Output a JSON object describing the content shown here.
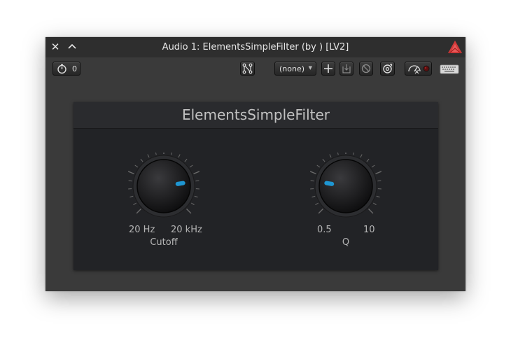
{
  "window": {
    "title": "Audio 1: ElementsSimpleFilter (by ) [LV2]"
  },
  "toolbar": {
    "latency_value": "0",
    "preset_selected": "(none)"
  },
  "plugin": {
    "title": "ElementsSimpleFilter",
    "knobs": [
      {
        "name": "Cutoff",
        "min_label": "20 Hz",
        "max_label": "20 kHz",
        "position": 0.8
      },
      {
        "name": "Q",
        "min_label": "0.5",
        "max_label": "10",
        "position": 0.2
      }
    ]
  },
  "colors": {
    "accent": "#1e96d2",
    "logo": "#d23a3a",
    "panel": "#222326",
    "window": "#3a3a3a"
  }
}
